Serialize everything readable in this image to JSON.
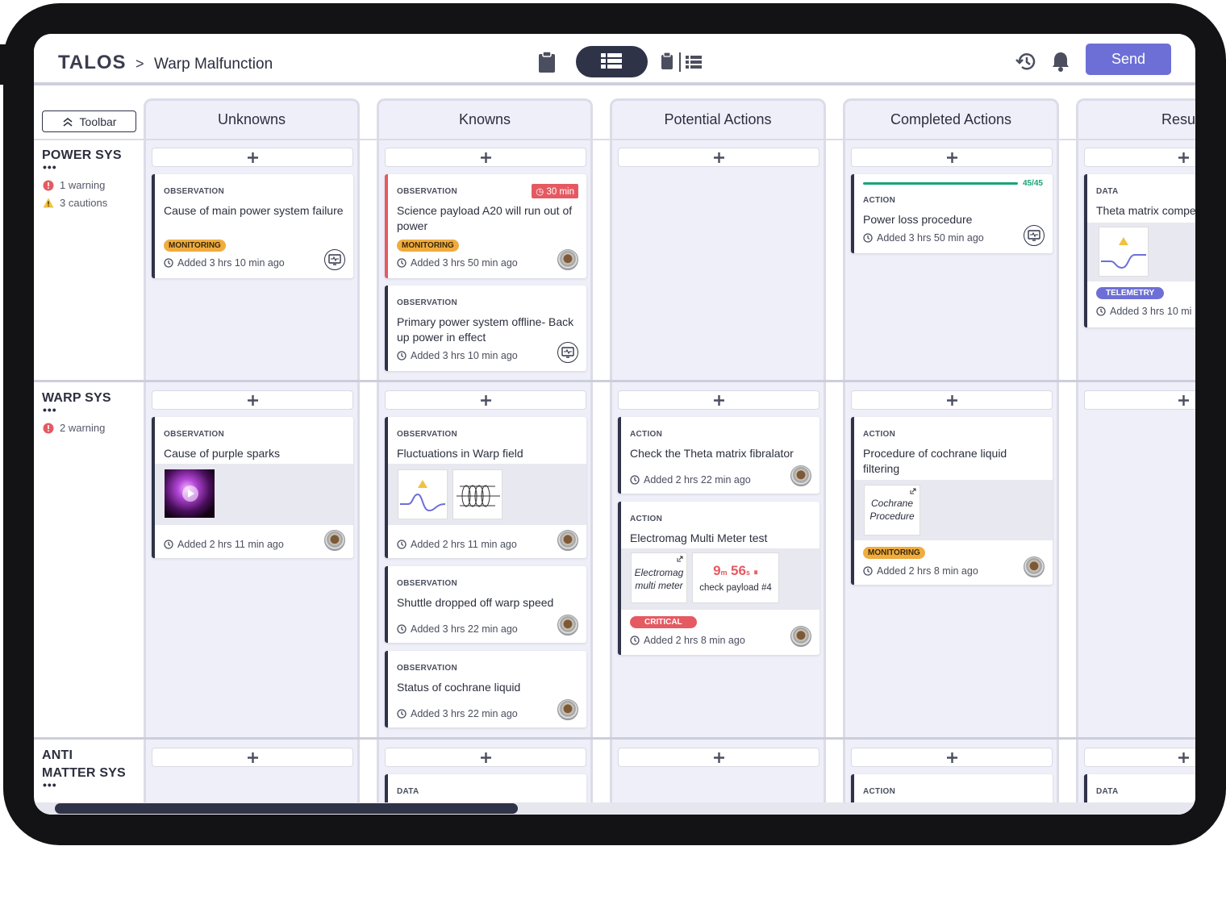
{
  "app": {
    "logo": "TALOS",
    "breadcrumb_sep": ">",
    "page_title": "Warp Malfunction"
  },
  "header": {
    "send_label": "Send"
  },
  "toolbar": {
    "label": "Toolbar"
  },
  "columns": [
    "Unknowns",
    "Knowns",
    "Potential Actions",
    "Completed Actions",
    "Resul"
  ],
  "rows": [
    {
      "name": "POWER SYS",
      "dots": "•••",
      "alerts": [
        {
          "type": "warning",
          "text": "1 warning"
        },
        {
          "type": "caution",
          "text": "3 cautions"
        }
      ]
    },
    {
      "name": "WARP SYS",
      "dots": "•••",
      "alerts": [
        {
          "type": "warning",
          "text": "2 warning"
        }
      ]
    },
    {
      "name_line1": "ANTI",
      "name_line2": "MATTER SYS",
      "dots": "•••"
    }
  ],
  "cards": {
    "p_u1": {
      "type": "OBSERVATION",
      "title": "Cause of main power system failure",
      "badge": "MONITORING",
      "time": "Added 3 hrs 10 min ago"
    },
    "p_k1": {
      "type": "OBSERVATION",
      "timer": "30 min",
      "title": "Science payload A20 will run out of power",
      "badge": "MONITORING",
      "time": "Added 3 hrs 50 min ago"
    },
    "p_k2": {
      "type": "OBSERVATION",
      "title": "Primary power system offline- Back up power in effect",
      "time": "Added 3 hrs 10 min ago"
    },
    "p_c1": {
      "progress": "45/45",
      "type": "ACTION",
      "title": "Power loss procedure",
      "time": "Added 3 hrs 50 min ago"
    },
    "p_r1": {
      "type": "DATA",
      "title": "Theta matrix compe",
      "badge": "TELEMETRY",
      "time": "Added 3 hrs 10 mi"
    },
    "w_u1": {
      "type": "OBSERVATION",
      "title": "Cause of purple sparks",
      "time": "Added 2 hrs 11 min ago"
    },
    "w_k1": {
      "type": "OBSERVATION",
      "title": "Fluctuations in Warp field",
      "time": "Added 2 hrs 11 min ago"
    },
    "w_k2": {
      "type": "OBSERVATION",
      "title": "Shuttle dropped off warp speed",
      "time": "Added 3 hrs 22 min ago"
    },
    "w_k3": {
      "type": "OBSERVATION",
      "title": "Status of cochrane liquid",
      "time": "Added 3 hrs 22 min ago"
    },
    "w_p1": {
      "type": "ACTION",
      "title": "Check the Theta matrix fibralator",
      "time": "Added 2 hrs 22 min ago"
    },
    "w_p2": {
      "type": "ACTION",
      "title": "Electromag Multi Meter test",
      "attach1_l1": "Electromag",
      "attach1_l2": "multi meter",
      "timer_m": "9",
      "timer_m_unit": "m",
      "timer_s": "56",
      "timer_s_unit": "s",
      "timer_label": "check payload #4",
      "badge": "CRITICAL",
      "time": "Added 2 hrs 8 min ago"
    },
    "w_c1": {
      "type": "ACTION",
      "title": "Procedure of cochrane liquid filtering",
      "attach1_l1": "Cochrane",
      "attach1_l2": "Procedure",
      "badge": "MONITORING",
      "time": "Added 2 hrs 8 min ago"
    },
    "a_k1": {
      "type": "DATA"
    },
    "a_c1": {
      "type": "ACTION"
    },
    "a_r1": {
      "type": "DATA"
    }
  },
  "colors": {
    "accent": "#6d6fd6",
    "dark": "#2f3348",
    "critical": "#e55a62",
    "monitoring": "#f0ac3e",
    "success": "#17a673"
  }
}
